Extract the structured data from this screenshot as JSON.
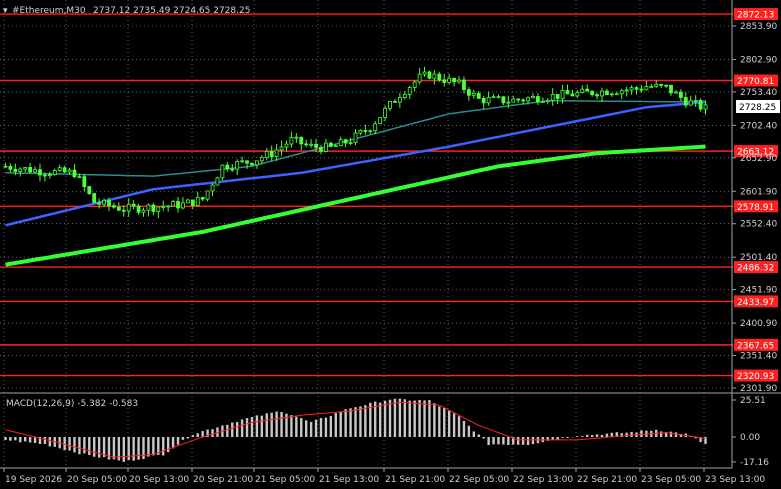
{
  "header": {
    "title": "#Ethereum,M30",
    "ohlc": "2737.12 2735.49 2724.65 2728.25"
  },
  "colors": {
    "background": "#000000",
    "grid": "#9aa3ab",
    "axis_text": "#d0d0d0",
    "candle_up": "#4cff3a",
    "candle_down": "#4cff3a",
    "ma_fast": "#2e8b8b",
    "ma_mid": "#4060ff",
    "ma_slow": "#33ff33",
    "level_line": "#ff2020",
    "level_label_bg": "#ff2020",
    "level_label_text": "#ffffff",
    "current_price_bg": "#ffffff",
    "current_price_text": "#000000",
    "macd_hist": "#c8c8c8",
    "macd_signal": "#ff2020"
  },
  "price_axis": {
    "ticks": [
      "2853.90",
      "2802.90",
      "2753.40",
      "2702.40",
      "2652.90",
      "2601.90",
      "2552.40",
      "2501.40",
      "2451.90",
      "2400.90",
      "2351.40",
      "2301.90"
    ],
    "current_price": "2728.25"
  },
  "levels": [
    "2872.13",
    "2770.81",
    "2663.12",
    "2578.91",
    "2486.32",
    "2433.97",
    "2367.65",
    "2320.93"
  ],
  "macd": {
    "label": "MACD(12,26,9) -5.382 -0.583",
    "ticks": [
      "25.51",
      "0.00",
      "-17.16"
    ]
  },
  "time_axis": {
    "labels": [
      "19 Sep 2026",
      "20 Sep 05:00",
      "20 Sep 13:00",
      "20 Sep 21:00",
      "21 Sep 05:00",
      "21 Sep 13:00",
      "21 Sep 21:00",
      "22 Sep 05:00",
      "22 Sep 13:00",
      "22 Sep 21:00",
      "23 Sep 05:00",
      "23 Sep 13:00"
    ]
  },
  "chart_data": {
    "type": "candlestick",
    "symbol": "#Ethereum",
    "timeframe": "M30",
    "ylim": [
      2290,
      2885
    ],
    "anchors_close": [
      [
        0,
        2640
      ],
      [
        8,
        2632
      ],
      [
        14,
        2630
      ],
      [
        18,
        2585
      ],
      [
        24,
        2575
      ],
      [
        30,
        2578
      ],
      [
        36,
        2582
      ],
      [
        40,
        2590
      ],
      [
        44,
        2640
      ],
      [
        50,
        2648
      ],
      [
        54,
        2660
      ],
      [
        58,
        2680
      ],
      [
        62,
        2670
      ],
      [
        66,
        2668
      ],
      [
        70,
        2680
      ],
      [
        74,
        2700
      ],
      [
        80,
        2750
      ],
      [
        84,
        2775
      ],
      [
        86,
        2780
      ],
      [
        92,
        2765
      ],
      [
        96,
        2742
      ],
      [
        102,
        2740
      ],
      [
        108,
        2745
      ],
      [
        112,
        2748
      ],
      [
        118,
        2752
      ],
      [
        122,
        2755
      ],
      [
        128,
        2758
      ],
      [
        130,
        2762
      ],
      [
        134,
        2760
      ],
      [
        138,
        2740
      ],
      [
        142,
        2728
      ]
    ],
    "ma_fast_anchors": [
      [
        0,
        2630
      ],
      [
        30,
        2625
      ],
      [
        50,
        2640
      ],
      [
        70,
        2680
      ],
      [
        90,
        2720
      ],
      [
        110,
        2740
      ],
      [
        142,
        2738
      ]
    ],
    "ma_mid_anchors": [
      [
        0,
        2550
      ],
      [
        30,
        2605
      ],
      [
        60,
        2630
      ],
      [
        90,
        2670
      ],
      [
        110,
        2700
      ],
      [
        130,
        2730
      ],
      [
        142,
        2738
      ]
    ],
    "ma_slow_anchors": [
      [
        0,
        2490
      ],
      [
        40,
        2540
      ],
      [
        70,
        2590
      ],
      [
        100,
        2640
      ],
      [
        120,
        2660
      ],
      [
        142,
        2670
      ]
    ],
    "macd_anchors": [
      [
        0,
        -2
      ],
      [
        8,
        -5
      ],
      [
        16,
        -12
      ],
      [
        24,
        -17
      ],
      [
        32,
        -12
      ],
      [
        38,
        2
      ],
      [
        48,
        12
      ],
      [
        56,
        18
      ],
      [
        62,
        10
      ],
      [
        70,
        20
      ],
      [
        78,
        26
      ],
      [
        86,
        25
      ],
      [
        92,
        14
      ],
      [
        98,
        -5
      ],
      [
        106,
        -5
      ],
      [
        116,
        1
      ],
      [
        126,
        3
      ],
      [
        132,
        5
      ],
      [
        138,
        2
      ],
      [
        142,
        -5
      ]
    ],
    "macd_signal_anchors": [
      [
        0,
        5
      ],
      [
        12,
        -5
      ],
      [
        22,
        -14
      ],
      [
        30,
        -12
      ],
      [
        40,
        0
      ],
      [
        50,
        10
      ],
      [
        60,
        15
      ],
      [
        70,
        18
      ],
      [
        80,
        24
      ],
      [
        88,
        22
      ],
      [
        96,
        8
      ],
      [
        104,
        -2
      ],
      [
        116,
        -2
      ],
      [
        126,
        1
      ],
      [
        134,
        3
      ],
      [
        142,
        -1
      ]
    ],
    "macd_ylim": [
      -22,
      30
    ]
  }
}
